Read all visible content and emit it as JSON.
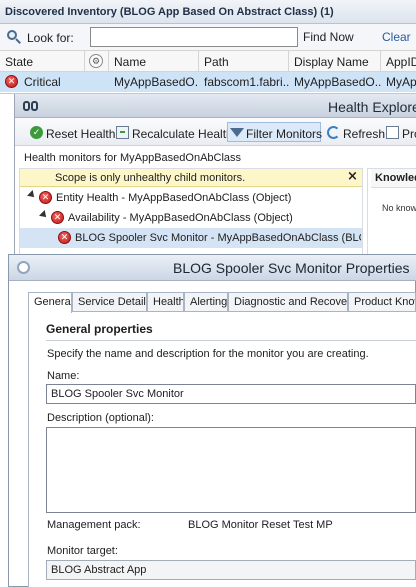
{
  "inventory": {
    "title": "Discovered Inventory (BLOG App Based On Abstract Class) (1)",
    "look_for_label": "Look for:",
    "search_value": "",
    "find_now_label": "Find Now",
    "clear_label": "Clear",
    "columns": [
      "State",
      "Name",
      "Path",
      "Display Name",
      "AppID"
    ],
    "row": {
      "state": "Critical",
      "name": "MyAppBasedO...",
      "path": "fabscom1.fabri...",
      "display_name": "MyAppBasedO...",
      "app_id": "MyAp"
    }
  },
  "health_explorer": {
    "title": "Health Explore",
    "toolbar": {
      "reset": "Reset Health",
      "recalc": "Recalculate Health",
      "filter": "Filter Monitors",
      "refresh": "Refresh",
      "props": "Pro"
    },
    "subtitle": "Health monitors for MyAppBasedOnAbClass",
    "scope_message": "Scope is only unhealthy child monitors.",
    "scope_close": "×",
    "tree": [
      "Entity Health - MyAppBasedOnAbClass (Object)",
      "Availability - MyAppBasedOnAbClass (Object)",
      "BLOG Spooler Svc Monitor - MyAppBasedOnAbClass (BLOG Ab"
    ],
    "knowledge_tab": "Knowledge",
    "knowledge_body": "No knowled"
  },
  "dialog": {
    "title": "BLOG Spooler Svc Monitor Properties",
    "tabs": [
      "General",
      "Service Details",
      "Health",
      "Alerting",
      "Diagnostic and Recovery",
      "Product Know"
    ],
    "general_heading": "General properties",
    "general_desc": "Specify the name and description for the monitor you are creating.",
    "name_label": "Name:",
    "name_value": "BLOG Spooler Svc Monitor",
    "description_label": "Description (optional):",
    "description_value": "",
    "management_pack_label": "Management pack:",
    "management_pack_value": "BLOG Monitor Reset Test MP",
    "monitor_target_label": "Monitor target:",
    "monitor_target_value": "BLOG Abstract App"
  },
  "icons": {
    "look_for": "search-icon",
    "state": "critical-icon",
    "name_col": "wrench-icon",
    "health_explorer": "binoculars-icon",
    "dialog": "window-icon"
  }
}
